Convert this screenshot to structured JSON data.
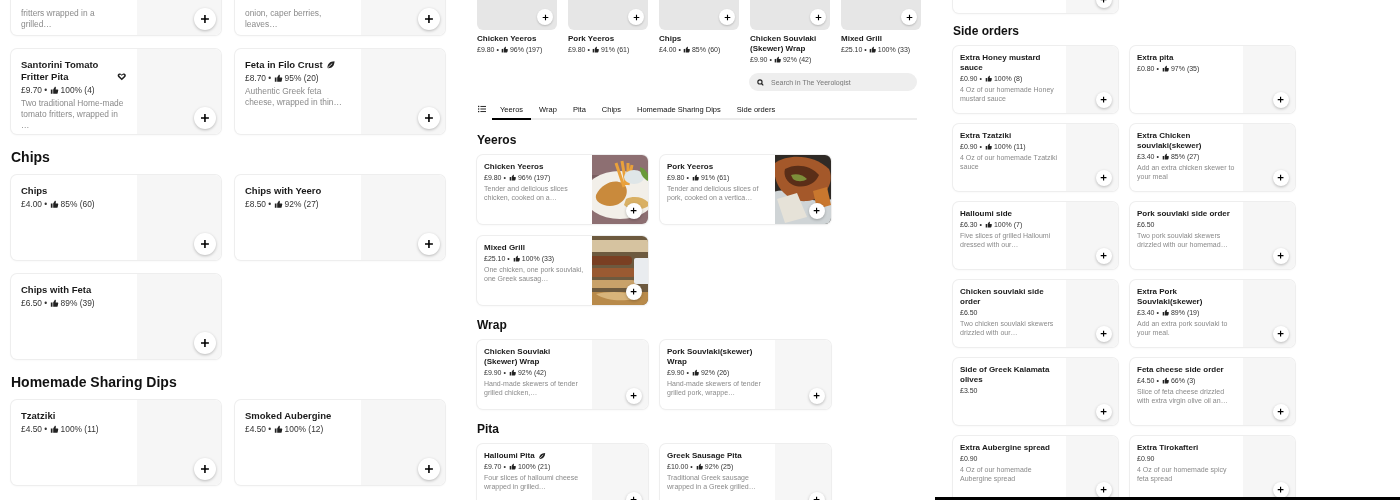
{
  "panels": [
    {
      "blocks": [
        {
          "kind": "section",
          "items": [
            {
              "kind": "partial",
              "description": "fritters wrapped in a grilled…",
              "photo": false
            },
            {
              "kind": "partial",
              "description": "onion, caper berries, leaves…",
              "photo": false
            },
            {
              "name": "Santorini Tomato Fritter Pita",
              "kind": "heart",
              "price": "£9.70 •",
              "rating": "100% (4)",
              "description": "Two traditional Home-made tomato fritters, wrapped in …",
              "photo": false
            },
            {
              "name": "Feta in Filo Crust",
              "kind": "leaf",
              "price": "£8.70 •",
              "rating": "95% (20)",
              "description": "Authentic Greek feta cheese, wrapped in thin…",
              "photo": false
            }
          ]
        },
        {
          "kind": "section",
          "heading": "Chips",
          "items": [
            {
              "name": "Chips",
              "price": "£4.00 •",
              "rating": "85% (60)",
              "photo": false
            },
            {
              "name": "Chips with Yeero",
              "price": "£8.50 •",
              "rating": "92% (27)",
              "photo": false
            },
            {
              "name": "Chips with Feta",
              "price": "£6.50 •",
              "rating": "89% (39)",
              "photo": false
            }
          ]
        },
        {
          "kind": "section",
          "heading": "Homemade Sharing Dips",
          "items": [
            {
              "name": "Tzatziki",
              "price": "£4.50 •",
              "rating": "100% (11)",
              "photo": false
            },
            {
              "name": "Smoked Aubergine",
              "price": "£4.50 •",
              "rating": "100% (12)",
              "photo": false
            }
          ]
        }
      ]
    },
    {
      "blocks": [
        {
          "kind": "carousel",
          "items": [
            {
              "name": "Chicken Yeeros",
              "price": "£9.80 •",
              "rating": "96% (197)"
            },
            {
              "name": "Pork Yeeros",
              "price": "£9.80 •",
              "rating": "91% (61)"
            },
            {
              "name": "Chips",
              "price": "£4.00 •",
              "rating": "85% (60)"
            },
            {
              "name": "Chicken Souvlaki (Skewer) Wrap",
              "price": "£9.90 •",
              "rating": "92% (42)"
            },
            {
              "name": "Mixed Grill",
              "price": "£25.10 •",
              "rating": "100% (33)"
            }
          ]
        },
        {
          "kind": "search",
          "placeholder": "Search in The Yeerologist"
        },
        {
          "kind": "tabs",
          "tabs": [
            {
              "label": "Yeeros",
              "selected": true
            },
            {
              "label": "Wrap",
              "selected": false
            },
            {
              "label": "Pita",
              "selected": false
            },
            {
              "label": "Chips",
              "selected": false
            },
            {
              "label": "Homemade Sharing Dips",
              "selected": false
            },
            {
              "label": "Side orders",
              "selected": false
            }
          ]
        },
        {
          "kind": "section",
          "heading": "Yeeros",
          "items": [
            {
              "name": "Chicken Yeeros",
              "price": "£9.80 •",
              "rating": "96% (197)",
              "description": "Tender and delicious slices chicken, cooked on a…",
              "photo": true
            },
            {
              "name": "Pork Yeeros",
              "price": "£9.80 •",
              "rating": "91% (61)",
              "description": "Tender and delicious slices of pork, cooked on a vertica…",
              "photo": true
            },
            {
              "name": "Mixed Grill",
              "price": "£25.10 •",
              "rating": "100% (33)",
              "description": "One chicken, one pork souvlaki, one Greek sausag…",
              "photo": true
            }
          ]
        },
        {
          "kind": "section",
          "heading": "Wrap",
          "items": [
            {
              "name": "Chicken Souvlaki (Skewer) Wrap",
              "price": "£9.90 •",
              "rating": "92% (42)",
              "description": "Hand-made skewers of tender grilled chicken,…",
              "photo": false
            },
            {
              "name": "Pork Souvlaki(skewer) Wrap",
              "price": "£9.90 •",
              "rating": "92% (26)",
              "description": "Hand-made skewers of tender grilled pork, wrappe…",
              "photo": false
            }
          ]
        },
        {
          "kind": "section",
          "heading": "Pita",
          "items": [
            {
              "name": "Halloumi Pita",
              "kind": "leaf",
              "price": "£9.70 •",
              "rating": "100% (21)",
              "description": "Four slices of halloumi cheese wrapped in grilled…",
              "photo": false
            },
            {
              "name": "Greek Sausage Pita",
              "price": "£10.00 •",
              "rating": "92% (25)",
              "description": "Traditional Greek sausage wrapped in a Greek grilled…",
              "photo": false
            }
          ]
        }
      ]
    },
    {
      "blocks": [
        {
          "kind": "section",
          "items": [
            {
              "kind": "partial"
            }
          ]
        },
        {
          "kind": "section",
          "heading": "Side orders",
          "items": [
            {
              "name": "Extra Honey mustard sauce",
              "price": "£0.90 •",
              "rating": "100% (8)",
              "description": "4 Oz of our homemade Honey mustard sauce",
              "photo": false
            },
            {
              "name": "Extra pita",
              "price": "£0.80 •",
              "rating": "97% (35)",
              "photo": false
            },
            {
              "name": "Extra Tzatziki",
              "price": "£0.90 •",
              "rating": "100% (11)",
              "description": "4 Oz of our homemade Tzatziki sauce",
              "photo": false
            },
            {
              "name": "Extra Chicken souvlaki(skewer)",
              "price": "£3.40 •",
              "rating": "85% (27)",
              "description": "Add an extra chicken skewer to your meal",
              "photo": false
            },
            {
              "name": "Halloumi side",
              "price": "£6.30 •",
              "rating": "100% (7)",
              "description": "Five slices of grilled Halloumi dressed with our…",
              "photo": false
            },
            {
              "name": "Pork souvlaki side order",
              "price": "£6.50",
              "description": "Two pork souvlaki skewers drizzled with our homemad…",
              "photo": false
            },
            {
              "name": "Chicken souvlaki side order",
              "price": "£6.50",
              "description": "Two chicken souvlaki skewers drizzled with our…",
              "photo": false
            },
            {
              "name": "Extra Pork Souvlaki(skewer)",
              "price": "£3.40 •",
              "rating": "89% (19)",
              "description": "Add an extra pork souvlaki to your meal.",
              "photo": false
            },
            {
              "name": "Side of Greek Kalamata olives",
              "price": "£3.50",
              "photo": false
            },
            {
              "name": "Feta cheese side order",
              "price": "£4.50 •",
              "rating": "66% (3)",
              "description": "Slice of feta cheese drizzled with extra virgin olive oil an…",
              "photo": false
            },
            {
              "name": "Extra Aubergine spread",
              "price": "£0.90",
              "description": "4 Oz of our homemade Aubergine spread",
              "photo": false
            },
            {
              "name": "Extra Tirokafteri",
              "price": "£0.90",
              "description": "4 Oz of our homemade spicy feta spread",
              "photo": false
            }
          ]
        }
      ]
    }
  ]
}
